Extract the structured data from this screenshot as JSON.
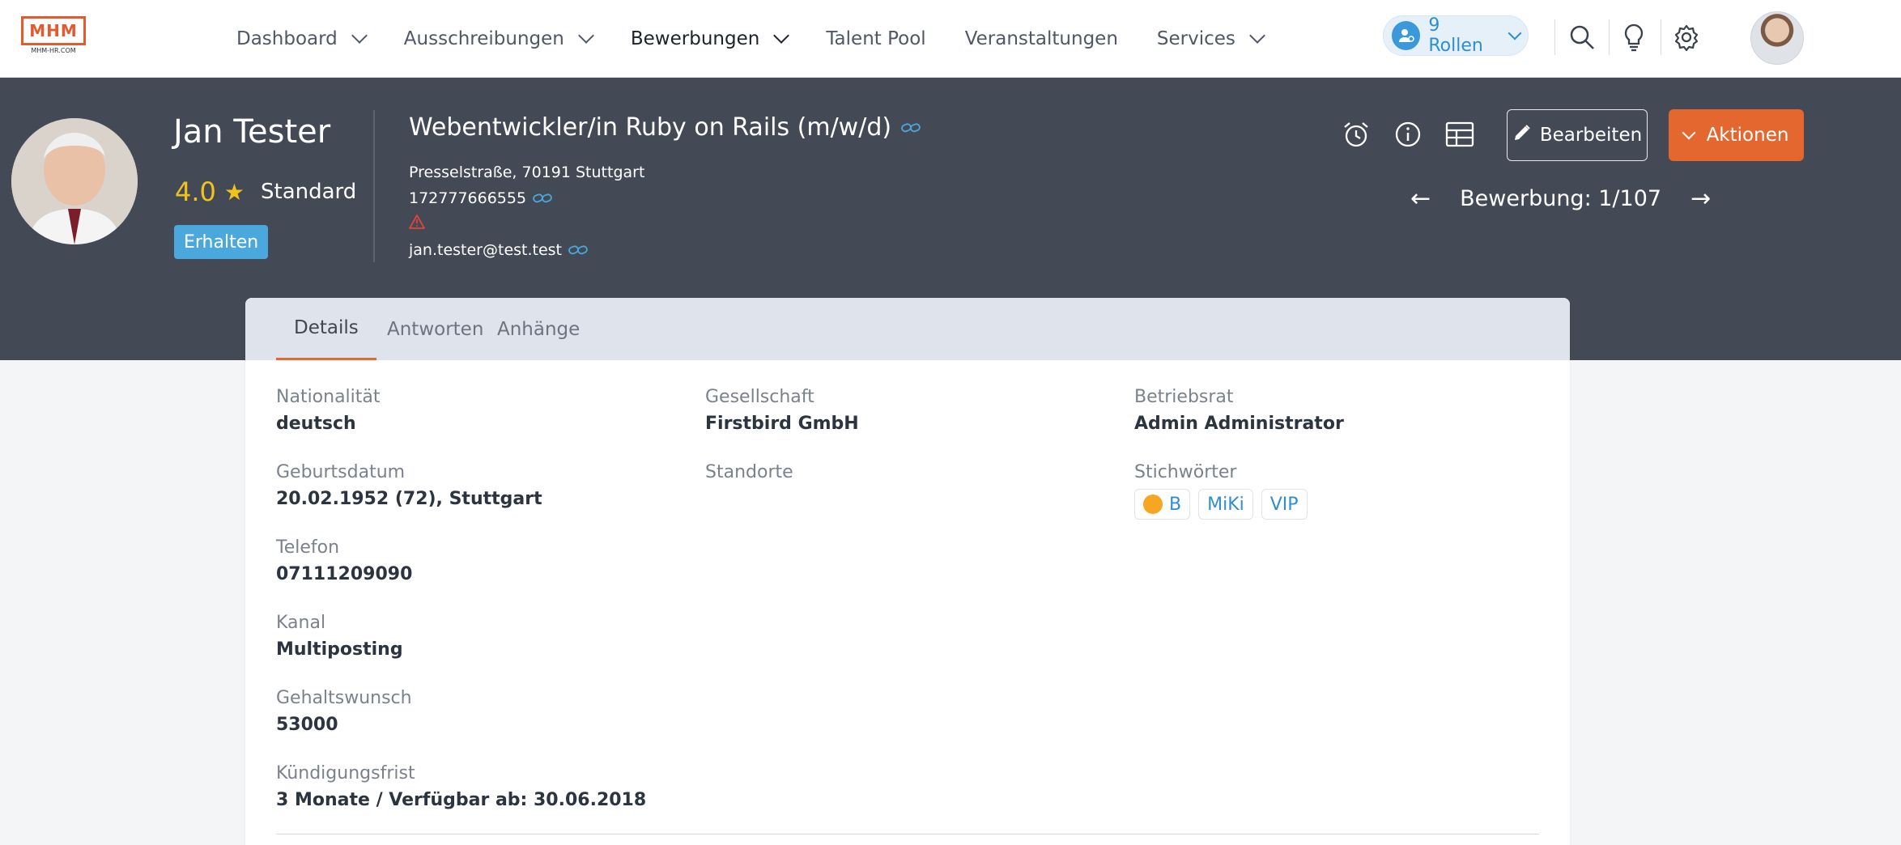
{
  "brand": {
    "logo_text": "MHM",
    "logo_sub": "MHM-HR.COM"
  },
  "nav": {
    "items": [
      {
        "label": "Dashboard",
        "has_menu": true,
        "active": false
      },
      {
        "label": "Ausschreibungen",
        "has_menu": true,
        "active": false
      },
      {
        "label": "Bewerbungen",
        "has_menu": true,
        "active": true
      },
      {
        "label": "Talent Pool",
        "has_menu": false,
        "active": false
      },
      {
        "label": "Veranstaltungen",
        "has_menu": false,
        "active": false
      },
      {
        "label": "Services",
        "has_menu": true,
        "active": false
      }
    ],
    "roles_label": "9 Rollen"
  },
  "candidate": {
    "name": "Jan Tester",
    "rating": "4.0",
    "rating_label": "Standard",
    "status": "Erhalten",
    "job_title": "Webentwickler/in Ruby on Rails (m/w/d)",
    "address": "Presselstraße, 70191 Stuttgart",
    "phone": "172777666555",
    "email": "jan.tester@test.test"
  },
  "header_actions": {
    "edit_label": "Bearbeiten",
    "actions_label": "Aktionen",
    "pager_label": "Bewerbung: 1/107"
  },
  "tabs": [
    {
      "label": "Details",
      "active": true
    },
    {
      "label": "Antworten",
      "active": false
    },
    {
      "label": "Anhänge",
      "active": false
    }
  ],
  "details": {
    "col1": [
      {
        "label": "Nationalität",
        "value": "deutsch"
      },
      {
        "label": "Geburtsdatum",
        "value": "20.02.1952 (72), Stuttgart"
      },
      {
        "label": "Telefon",
        "value": "07111209090"
      },
      {
        "label": "Kanal",
        "value": "Multiposting"
      },
      {
        "label": "Gehaltswunsch",
        "value": "53000"
      },
      {
        "label": "Kündigungsfrist",
        "value": "3 Monate / Verfügbar ab: 30.06.2018"
      }
    ],
    "col2": [
      {
        "label": "Gesellschaft",
        "value": "Firstbird GmbH"
      },
      {
        "label": "Standorte",
        "value": ""
      }
    ],
    "col3": [
      {
        "label": "Betriebsrat",
        "value": "Admin Administrator"
      },
      {
        "label": "Stichwörter",
        "tags": [
          "B",
          "MiKi",
          "VIP"
        ]
      }
    ]
  },
  "colors": {
    "accent": "#e3672f",
    "header_bg": "#434a55",
    "link": "#2e8ed0",
    "star": "#f2c21c"
  }
}
